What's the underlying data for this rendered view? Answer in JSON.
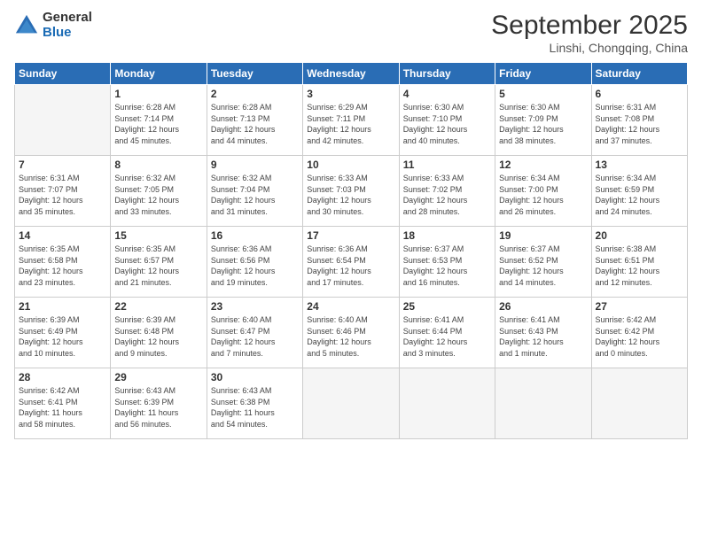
{
  "logo": {
    "general": "General",
    "blue": "Blue"
  },
  "header": {
    "month": "September 2025",
    "location": "Linshi, Chongqing, China"
  },
  "days_of_week": [
    "Sunday",
    "Monday",
    "Tuesday",
    "Wednesday",
    "Thursday",
    "Friday",
    "Saturday"
  ],
  "weeks": [
    [
      {
        "day": "",
        "info": ""
      },
      {
        "day": "1",
        "info": "Sunrise: 6:28 AM\nSunset: 7:14 PM\nDaylight: 12 hours\nand 45 minutes."
      },
      {
        "day": "2",
        "info": "Sunrise: 6:28 AM\nSunset: 7:13 PM\nDaylight: 12 hours\nand 44 minutes."
      },
      {
        "day": "3",
        "info": "Sunrise: 6:29 AM\nSunset: 7:11 PM\nDaylight: 12 hours\nand 42 minutes."
      },
      {
        "day": "4",
        "info": "Sunrise: 6:30 AM\nSunset: 7:10 PM\nDaylight: 12 hours\nand 40 minutes."
      },
      {
        "day": "5",
        "info": "Sunrise: 6:30 AM\nSunset: 7:09 PM\nDaylight: 12 hours\nand 38 minutes."
      },
      {
        "day": "6",
        "info": "Sunrise: 6:31 AM\nSunset: 7:08 PM\nDaylight: 12 hours\nand 37 minutes."
      }
    ],
    [
      {
        "day": "7",
        "info": "Sunrise: 6:31 AM\nSunset: 7:07 PM\nDaylight: 12 hours\nand 35 minutes."
      },
      {
        "day": "8",
        "info": "Sunrise: 6:32 AM\nSunset: 7:05 PM\nDaylight: 12 hours\nand 33 minutes."
      },
      {
        "day": "9",
        "info": "Sunrise: 6:32 AM\nSunset: 7:04 PM\nDaylight: 12 hours\nand 31 minutes."
      },
      {
        "day": "10",
        "info": "Sunrise: 6:33 AM\nSunset: 7:03 PM\nDaylight: 12 hours\nand 30 minutes."
      },
      {
        "day": "11",
        "info": "Sunrise: 6:33 AM\nSunset: 7:02 PM\nDaylight: 12 hours\nand 28 minutes."
      },
      {
        "day": "12",
        "info": "Sunrise: 6:34 AM\nSunset: 7:00 PM\nDaylight: 12 hours\nand 26 minutes."
      },
      {
        "day": "13",
        "info": "Sunrise: 6:34 AM\nSunset: 6:59 PM\nDaylight: 12 hours\nand 24 minutes."
      }
    ],
    [
      {
        "day": "14",
        "info": "Sunrise: 6:35 AM\nSunset: 6:58 PM\nDaylight: 12 hours\nand 23 minutes."
      },
      {
        "day": "15",
        "info": "Sunrise: 6:35 AM\nSunset: 6:57 PM\nDaylight: 12 hours\nand 21 minutes."
      },
      {
        "day": "16",
        "info": "Sunrise: 6:36 AM\nSunset: 6:56 PM\nDaylight: 12 hours\nand 19 minutes."
      },
      {
        "day": "17",
        "info": "Sunrise: 6:36 AM\nSunset: 6:54 PM\nDaylight: 12 hours\nand 17 minutes."
      },
      {
        "day": "18",
        "info": "Sunrise: 6:37 AM\nSunset: 6:53 PM\nDaylight: 12 hours\nand 16 minutes."
      },
      {
        "day": "19",
        "info": "Sunrise: 6:37 AM\nSunset: 6:52 PM\nDaylight: 12 hours\nand 14 minutes."
      },
      {
        "day": "20",
        "info": "Sunrise: 6:38 AM\nSunset: 6:51 PM\nDaylight: 12 hours\nand 12 minutes."
      }
    ],
    [
      {
        "day": "21",
        "info": "Sunrise: 6:39 AM\nSunset: 6:49 PM\nDaylight: 12 hours\nand 10 minutes."
      },
      {
        "day": "22",
        "info": "Sunrise: 6:39 AM\nSunset: 6:48 PM\nDaylight: 12 hours\nand 9 minutes."
      },
      {
        "day": "23",
        "info": "Sunrise: 6:40 AM\nSunset: 6:47 PM\nDaylight: 12 hours\nand 7 minutes."
      },
      {
        "day": "24",
        "info": "Sunrise: 6:40 AM\nSunset: 6:46 PM\nDaylight: 12 hours\nand 5 minutes."
      },
      {
        "day": "25",
        "info": "Sunrise: 6:41 AM\nSunset: 6:44 PM\nDaylight: 12 hours\nand 3 minutes."
      },
      {
        "day": "26",
        "info": "Sunrise: 6:41 AM\nSunset: 6:43 PM\nDaylight: 12 hours\nand 1 minute."
      },
      {
        "day": "27",
        "info": "Sunrise: 6:42 AM\nSunset: 6:42 PM\nDaylight: 12 hours\nand 0 minutes."
      }
    ],
    [
      {
        "day": "28",
        "info": "Sunrise: 6:42 AM\nSunset: 6:41 PM\nDaylight: 11 hours\nand 58 minutes."
      },
      {
        "day": "29",
        "info": "Sunrise: 6:43 AM\nSunset: 6:39 PM\nDaylight: 11 hours\nand 56 minutes."
      },
      {
        "day": "30",
        "info": "Sunrise: 6:43 AM\nSunset: 6:38 PM\nDaylight: 11 hours\nand 54 minutes."
      },
      {
        "day": "",
        "info": ""
      },
      {
        "day": "",
        "info": ""
      },
      {
        "day": "",
        "info": ""
      },
      {
        "day": "",
        "info": ""
      }
    ]
  ]
}
